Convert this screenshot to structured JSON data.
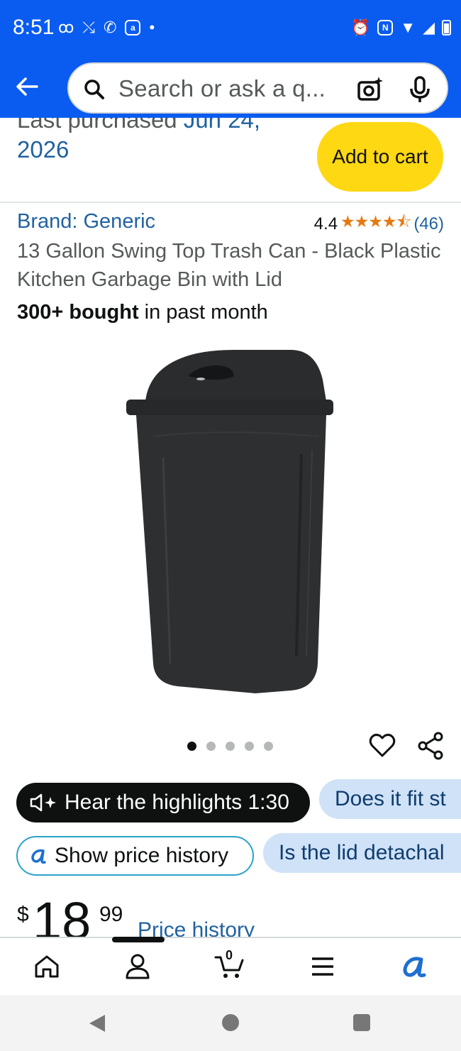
{
  "status_bar": {
    "time": "8:51",
    "left_icons": [
      "voicemail-icon",
      "missed-call-icon",
      "whatsapp-icon",
      "app-notification-icon",
      "dot-icon"
    ],
    "right_icons": [
      "alarm-icon",
      "nfc-icon",
      "wifi-icon",
      "signal-icon",
      "battery-icon"
    ],
    "nfc_letter": "N",
    "app_letter": "a"
  },
  "search": {
    "placeholder": "Search or ask a q..."
  },
  "purchase_history": {
    "prefix": "Last purchased ",
    "date_line1": "Jun 24,",
    "date_line2": "2026",
    "add_to_cart_label": "Add to cart"
  },
  "product": {
    "brand": "Brand: Generic",
    "rating": "4.4",
    "stars": "★★★★⯪",
    "review_count": "(46)",
    "title": "13 Gallon Swing Top Trash Can - Black Plastic Kitchen Garbage Bin with Lid",
    "bought_bold": "300+ bought",
    "bought_rest": " in past month",
    "image_count": 5,
    "active_image": 1
  },
  "chips": {
    "hear_highlights": "Hear the highlights 1:30",
    "fit_question": "Does it fit st",
    "show_price_history": "Show price history",
    "lid_question": "Is the lid detachal"
  },
  "price": {
    "symbol": "$",
    "whole": "18",
    "fraction": "99",
    "link": "Price history"
  },
  "bottom_nav": {
    "items": [
      "home-icon",
      "account-icon",
      "cart-icon",
      "menu-icon",
      "rufus-icon"
    ],
    "cart_count": "0"
  },
  "colors": {
    "header_blue": "#0a5cf0",
    "link_blue": "#2162a1",
    "cart_yellow": "#ffd814",
    "star_orange": "#e47911",
    "chip_blue": "#cfe2f7"
  }
}
